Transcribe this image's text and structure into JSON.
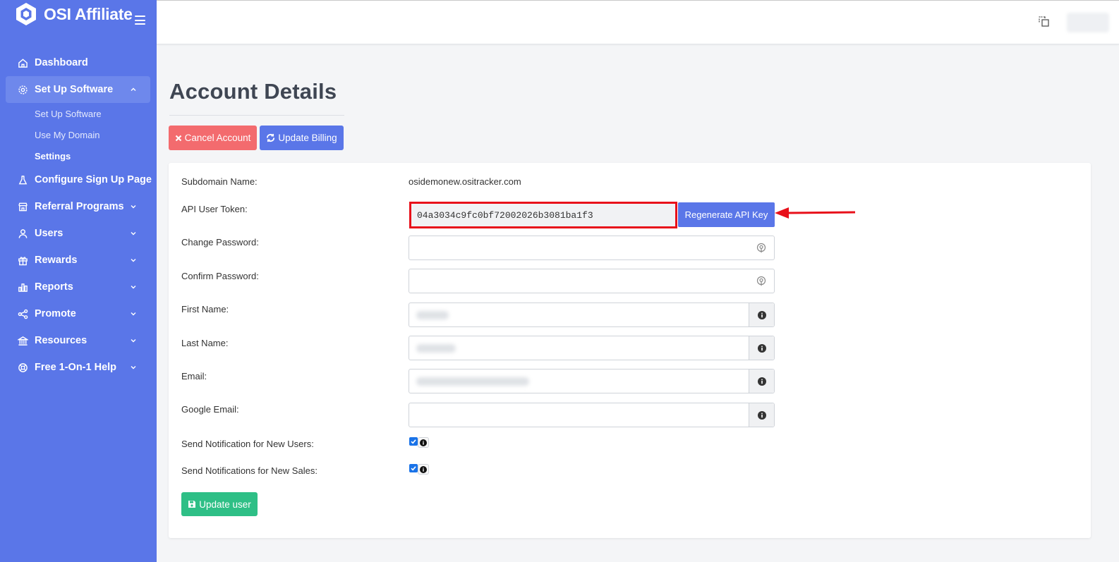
{
  "app": {
    "name": "OSI Affiliate"
  },
  "sidebar": {
    "items": [
      {
        "label": "Dashboard",
        "icon": "home-icon"
      },
      {
        "label": "Set Up Software",
        "icon": "gear-icon",
        "expanded": true,
        "children": [
          {
            "label": "Set Up Software"
          },
          {
            "label": "Use My Domain"
          },
          {
            "label": "Settings",
            "current": true
          }
        ]
      },
      {
        "label": "Configure Sign Up Page",
        "icon": "flask-icon"
      },
      {
        "label": "Referral Programs",
        "icon": "store-icon"
      },
      {
        "label": "Users",
        "icon": "user-icon"
      },
      {
        "label": "Rewards",
        "icon": "gift-icon"
      },
      {
        "label": "Reports",
        "icon": "bar-chart-icon"
      },
      {
        "label": "Promote",
        "icon": "share-icon"
      },
      {
        "label": "Resources",
        "icon": "bank-icon"
      },
      {
        "label": "Free 1-On-1 Help",
        "icon": "lifebuoy-icon"
      }
    ]
  },
  "page": {
    "title": "Account Details",
    "buttons": {
      "cancel": "Cancel Account",
      "billing": "Update Billing"
    }
  },
  "form": {
    "subdomain": {
      "label": "Subdomain Name:",
      "value": "osidemonew.ositracker.com"
    },
    "token": {
      "label": "API User Token:",
      "value": "04a3034c9fc0bf72002026b3081ba1f3",
      "button": "Regenerate API Key"
    },
    "change_password": {
      "label": "Change Password:",
      "value": ""
    },
    "confirm_password": {
      "label": "Confirm Password:",
      "value": ""
    },
    "first_name": {
      "label": "First Name:"
    },
    "last_name": {
      "label": "Last Name:"
    },
    "email": {
      "label": "Email:"
    },
    "google_email": {
      "label": "Google Email:",
      "value": ""
    },
    "notify_users": {
      "label": "Send Notification for New Users:",
      "checked": true
    },
    "notify_sales": {
      "label": "Send Notifications for New Sales:",
      "checked": true
    },
    "submit": "Update user"
  },
  "colors": {
    "sidebar": "#5a76e8",
    "danger": "#f36b6e",
    "primary": "#5a76e8",
    "success": "#2ebf86",
    "highlight": "#e8101a"
  }
}
